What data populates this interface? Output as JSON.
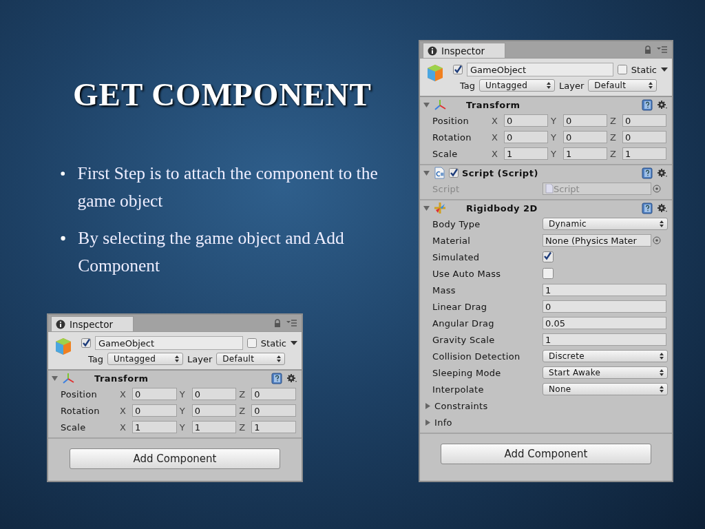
{
  "slide": {
    "title": "GET COMPONENT",
    "bullets": [
      "First Step is to attach the component to the game object",
      "By selecting the game object and Add Component"
    ]
  },
  "inspectors": [
    {
      "tab": "Inspector",
      "object": {
        "active": true,
        "name": "GameObject",
        "static": false,
        "static_label": "Static",
        "tag_label": "Tag",
        "tag": "Untagged",
        "layer_label": "Layer",
        "layer": "Default"
      },
      "components": [
        {
          "kind": "transform",
          "title": "Transform",
          "expanded": true,
          "rows": [
            {
              "label": "Position",
              "fields": [
                {
                  "axis": "X",
                  "value": "0"
                },
                {
                  "axis": "Y",
                  "value": "0"
                },
                {
                  "axis": "Z",
                  "value": "0"
                }
              ]
            },
            {
              "label": "Rotation",
              "fields": [
                {
                  "axis": "X",
                  "value": "0"
                },
                {
                  "axis": "Y",
                  "value": "0"
                },
                {
                  "axis": "Z",
                  "value": "0"
                }
              ]
            },
            {
              "label": "Scale",
              "fields": [
                {
                  "axis": "X",
                  "value": "1"
                },
                {
                  "axis": "Y",
                  "value": "1"
                },
                {
                  "axis": "Z",
                  "value": "1"
                }
              ]
            }
          ]
        }
      ],
      "add_button": "Add Component"
    },
    {
      "tab": "Inspector",
      "object": {
        "active": true,
        "name": "GameObject",
        "static": false,
        "static_label": "Static",
        "tag_label": "Tag",
        "tag": "Untagged",
        "layer_label": "Layer",
        "layer": "Default"
      },
      "components": [
        {
          "kind": "transform",
          "title": "Transform",
          "expanded": true,
          "rows": [
            {
              "label": "Position",
              "fields": [
                {
                  "axis": "X",
                  "value": "0"
                },
                {
                  "axis": "Y",
                  "value": "0"
                },
                {
                  "axis": "Z",
                  "value": "0"
                }
              ]
            },
            {
              "label": "Rotation",
              "fields": [
                {
                  "axis": "X",
                  "value": "0"
                },
                {
                  "axis": "Y",
                  "value": "0"
                },
                {
                  "axis": "Z",
                  "value": "0"
                }
              ]
            },
            {
              "label": "Scale",
              "fields": [
                {
                  "axis": "X",
                  "value": "1"
                },
                {
                  "axis": "Y",
                  "value": "1"
                },
                {
                  "axis": "Z",
                  "value": "1"
                }
              ]
            }
          ]
        },
        {
          "kind": "script",
          "title": "Script (Script)",
          "expanded": true,
          "enabled": true,
          "rows": [
            {
              "label": "Script",
              "value": "Script",
              "disabled": true
            }
          ]
        },
        {
          "kind": "rigidbody",
          "title": "Rigidbody 2D",
          "expanded": true,
          "rows": [
            {
              "kind": "dropdown",
              "label": "Body Type",
              "value": "Dynamic"
            },
            {
              "kind": "object",
              "label": "Material",
              "value": "None (Physics Mater"
            },
            {
              "kind": "checkbox",
              "label": "Simulated",
              "checked": true
            },
            {
              "kind": "checkbox",
              "label": "Use Auto Mass",
              "checked": false
            },
            {
              "kind": "number",
              "label": "Mass",
              "value": "1"
            },
            {
              "kind": "number",
              "label": "Linear Drag",
              "value": "0"
            },
            {
              "kind": "number",
              "label": "Angular Drag",
              "value": "0.05"
            },
            {
              "kind": "number",
              "label": "Gravity Scale",
              "value": "1"
            },
            {
              "kind": "dropdown",
              "label": "Collision Detection",
              "value": "Discrete"
            },
            {
              "kind": "dropdown",
              "label": "Sleeping Mode",
              "value": "Start Awake"
            },
            {
              "kind": "dropdown",
              "label": "Interpolate",
              "value": "None"
            },
            {
              "kind": "foldout",
              "label": "Constraints",
              "expanded": false
            },
            {
              "kind": "foldout",
              "label": "Info",
              "expanded": false
            }
          ]
        }
      ],
      "add_button": "Add Component"
    }
  ]
}
